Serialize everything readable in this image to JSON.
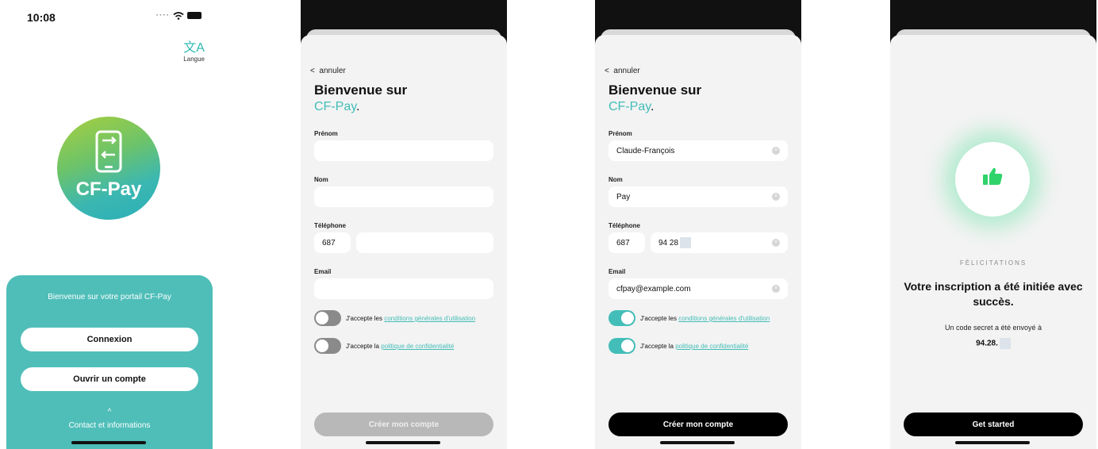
{
  "splash": {
    "time": "10:08",
    "lang_label": "Langue",
    "logo_text": "CF-Pay",
    "welcome": "Bienvenue sur votre portail CF-Pay",
    "login": "Connexion",
    "open_account": "Ouvrir un compte",
    "contact": "Contact et informations"
  },
  "form": {
    "cancel": "annuler",
    "title_line1": "Bienvenue sur",
    "title_brand": "CF-Pay",
    "title_dot": ".",
    "first_name_label": "Prénom",
    "last_name_label": "Nom",
    "phone_label": "Téléphone",
    "phone_prefix": "687",
    "email_label": "Email",
    "terms_prefix": "J'accepte les ",
    "terms_link": "conditions générales d'utilisation",
    "privacy_prefix": "J'accepte la ",
    "privacy_link": "politique de confidentialité",
    "submit": "Créer mon compte"
  },
  "filled": {
    "first_name": "Claude-François",
    "last_name": "Pay",
    "phone": "94 28",
    "email": "cfpay@example.com"
  },
  "success": {
    "eyebrow": "FÉLICITATIONS",
    "title": "Votre inscription a été initiée avec succès.",
    "secret_msg": "Un code secret a été envoyé à",
    "phone": "94.28.",
    "cta": "Get started"
  },
  "colors": {
    "accent": "#43bdb8",
    "panel": "#4fbeb9",
    "success_glow": "#3cdc8c"
  }
}
